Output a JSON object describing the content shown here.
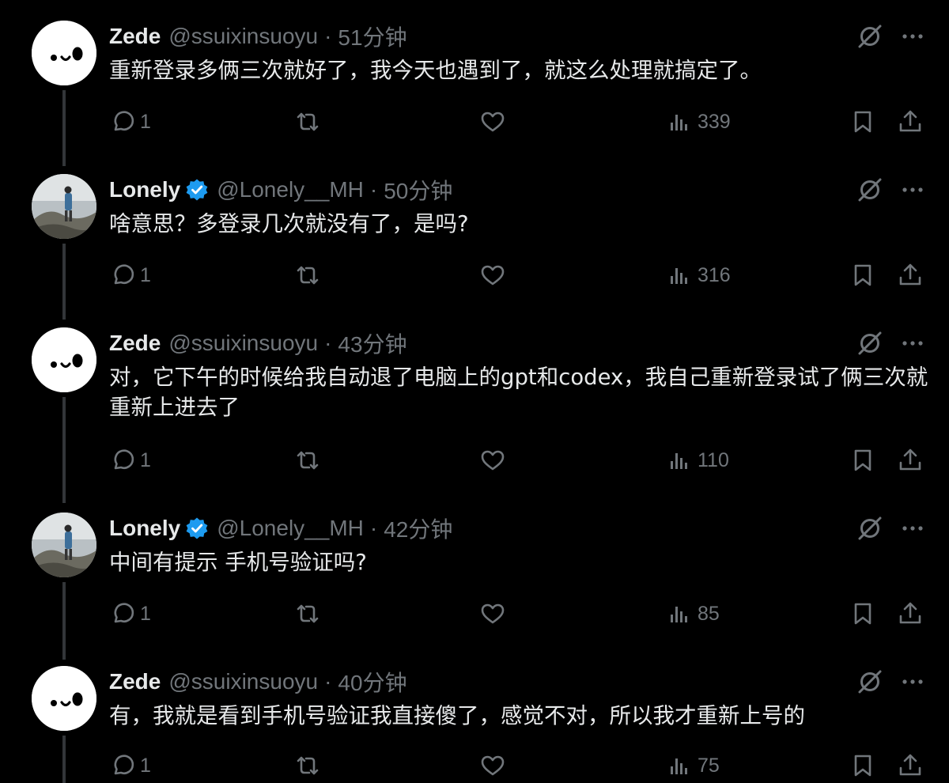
{
  "colors": {
    "background": "#000000",
    "text": "#e7e9ea",
    "muted": "#71767b",
    "verified": "#1d9bf0",
    "thread_line": "#333639"
  },
  "icons": {
    "reply": "reply-icon",
    "retweet": "retweet-icon",
    "like": "heart-icon",
    "views": "views-icon",
    "bookmark": "bookmark-icon",
    "share": "share-icon",
    "grok": "grok-icon",
    "more": "more-icon"
  },
  "tweets": [
    {
      "name": "Zede",
      "handle": "@ssuixinsuoyu",
      "separator": "·",
      "time": "51分钟",
      "verified": false,
      "text": "重新登录多俩三次就好了，我今天也遇到了，就这么处理就搞定了。",
      "replies": "1",
      "views": "339"
    },
    {
      "name": "Lonely",
      "handle": "@Lonely__MH",
      "separator": "·",
      "time": "50分钟",
      "verified": true,
      "text": "啥意思？多登录几次就没有了，是吗?",
      "replies": "1",
      "views": "316"
    },
    {
      "name": "Zede",
      "handle": "@ssuixinsuoyu",
      "separator": "·",
      "time": "43分钟",
      "verified": false,
      "text": "对，它下午的时候给我自动退了电脑上的gpt和codex，我自己重新登录试了俩三次就重新上进去了",
      "replies": "1",
      "views": "110"
    },
    {
      "name": "Lonely",
      "handle": "@Lonely__MH",
      "separator": "·",
      "time": "42分钟",
      "verified": true,
      "text": "中间有提示 手机号验证吗?",
      "replies": "1",
      "views": "85"
    },
    {
      "name": "Zede",
      "handle": "@ssuixinsuoyu",
      "separator": "·",
      "time": "40分钟",
      "verified": false,
      "text": "有，我就是看到手机号验证我直接傻了，感觉不对，所以我才重新上号的",
      "replies": "1",
      "views": "75"
    }
  ]
}
